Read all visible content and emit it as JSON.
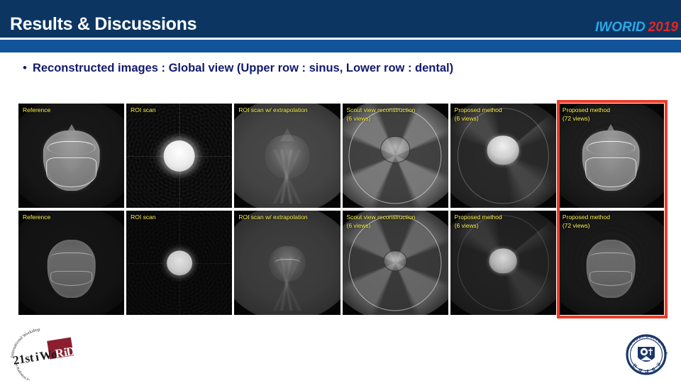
{
  "header": {
    "title": "Results & Discussions",
    "conference_logo": {
      "name": "IWORID",
      "year": "2019",
      "name_color": "#2ea7e8",
      "year_color": "#e8241f"
    },
    "bar_dark_color": "#0c3661",
    "bar_blue_color": "#12549a"
  },
  "bullet": {
    "marker": "•",
    "text": "Reconstructed images : Global view (Upper row : sinus, Lower row : dental)",
    "color": "#121a6e"
  },
  "grid": {
    "label_color": "#fff34d",
    "highlight_color": "#ee3b28",
    "columns": [
      "Reference",
      "ROI scan",
      "ROI scan w/ extrapolation",
      "Scout view reconstruction\n(6 views)",
      "Proposed method\n(6 views)",
      "Proposed method\n(72 views)"
    ],
    "rows": [
      {
        "row_name": "sinus",
        "cells": [
          {
            "label": "Reference"
          },
          {
            "label": "ROI scan"
          },
          {
            "label": "ROI scan w/ extrapolation"
          },
          {
            "label": "Scout view reconstruction\n(6 views)"
          },
          {
            "label": "Proposed method\n(6 views)"
          },
          {
            "label": "Proposed method\n(72 views)"
          }
        ]
      },
      {
        "row_name": "dental",
        "cells": [
          {
            "label": "Reference"
          },
          {
            "label": "ROI scan"
          },
          {
            "label": "ROI scan w/ extrapolation"
          },
          {
            "label": "Scout view reconstruction\n(6 views)"
          },
          {
            "label": "Proposed method\n(6 views)"
          },
          {
            "label": "Proposed method\n(72 views)"
          }
        ]
      }
    ]
  },
  "footer": {
    "iworid_logo": {
      "main_text": "21st iWoRiD",
      "top_arc": "International Workshop",
      "bottom_arc": "on Radiation Imaging Detectors",
      "accent_color": "#8c1f2f"
    },
    "yonsei_logo": {
      "top_text": "YONSEI UNIVERSITY",
      "bottom_text": "연 세 대 학 교",
      "color": "#1b3668"
    }
  }
}
